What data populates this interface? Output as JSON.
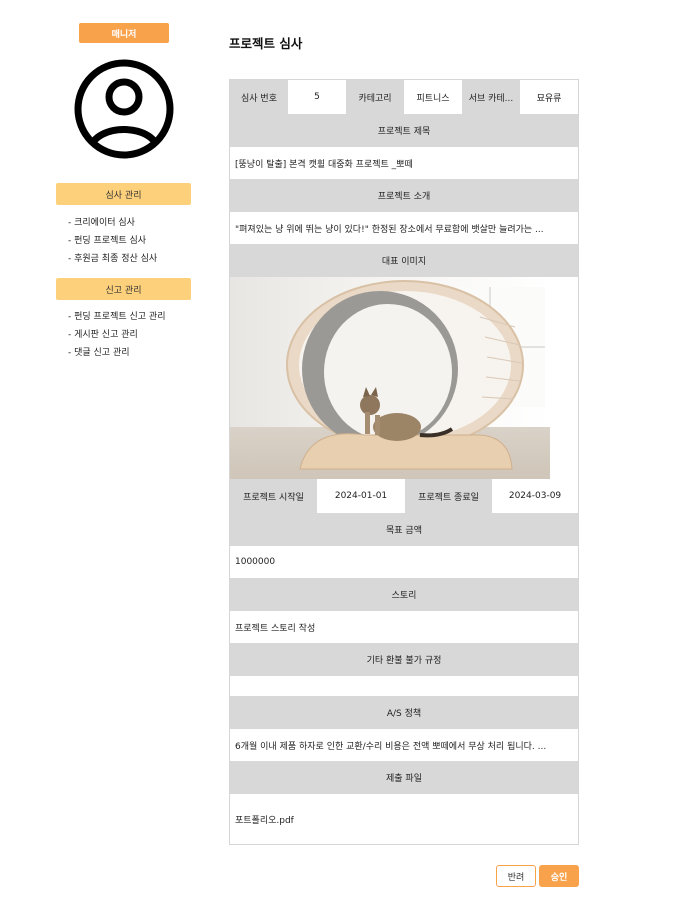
{
  "sidebar": {
    "role_badge": "매니저",
    "review_header": "심사 관리",
    "review_items": [
      "- 크리에이터 심사",
      "- 펀딩 프로젝트 심사",
      "- 후원금 최종 정산 심사"
    ],
    "report_header": "신고 관리",
    "report_items": [
      "- 펀딩 프로젝트 신고 관리",
      "- 게시판 신고 관리",
      "- 댓글 신고 관리"
    ]
  },
  "page": {
    "title": "프로젝트 심사"
  },
  "form": {
    "review_no_label": "심사 번호",
    "review_no": "5",
    "category_label": "카테고리",
    "category": "피트니스",
    "subcategory_label": "서브 카테...",
    "subcategory": "묘유류",
    "title_label": "프로젝트 제목",
    "title": "[뚱냥이 탈출] 본격 캣휠 대중화 프로젝트 _뽀떼",
    "intro_label": "프로젝트 소개",
    "intro": "\"펴져있는 냥 위에 뛰는 냥이 있다!\" 한정된 장소에서 무료함에 뱃살만 늘려가는 ...",
    "image_label": "대표 이미지",
    "start_label": "프로젝트 시작일",
    "start_date": "2024-01-01",
    "end_label": "프로젝트 종료일",
    "end_date": "2024-03-09",
    "goal_label": "목표 금액",
    "goal": "1000000",
    "story_label": "스토리",
    "story": "프로젝트 스토리 작성",
    "refund_label": "기타 환불 불가 규정",
    "refund": "",
    "as_label": "A/S 정책",
    "as_policy": "6개월 이내 제품 하자로 인한 교환/수리 비용은 전액 뽀떼에서 무상 처리 됩니다. ...",
    "file_label": "제출 파일",
    "file": "포트폴리오.pdf"
  },
  "actions": {
    "reject": "반려",
    "approve": "승인"
  },
  "colors": {
    "accent": "#f9a24c",
    "menu_header": "#fdd07c",
    "label_bg": "#d8d8d8"
  },
  "icons": {
    "avatar": "user-circle-icon"
  }
}
